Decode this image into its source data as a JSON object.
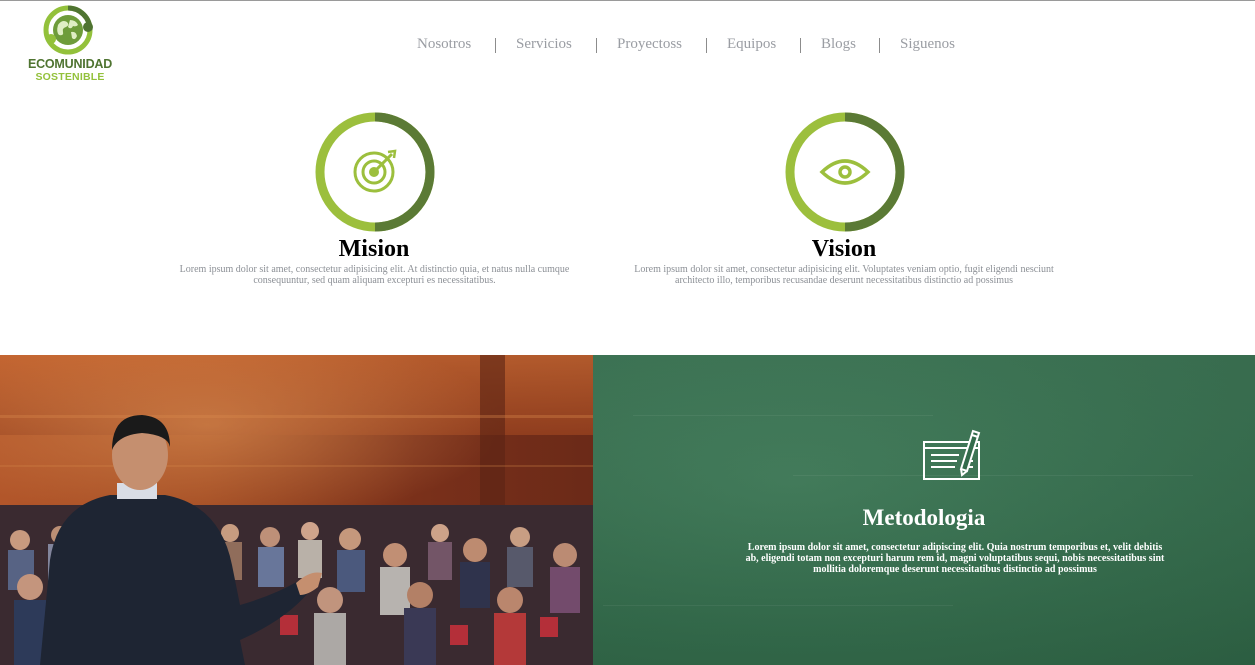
{
  "logo": {
    "line1": "ECOMUNIDAD",
    "line2": "SOSTENIBLE"
  },
  "nav": {
    "items": [
      "Nosotros",
      "Servicios",
      "Proyectoss",
      "Equipos",
      "Blogs",
      "Siguenos"
    ]
  },
  "features": [
    {
      "icon": "target-icon",
      "title": "Mision",
      "text": "Lorem ipsum dolor sit amet, consectetur adipisicing elit. At distinctio quia, et natus nulla cumque consequuntur, sed quam aliquam excepturi es necessitatibus."
    },
    {
      "icon": "eye-icon",
      "title": "Vision",
      "text": "Lorem ipsum dolor sit amet, consectetur adipisicing elit. Voluptates veniam optio, fugit eligendi nesciunt architecto illo, temporibus recusandae deserunt necessitatibus distinctio ad possimus"
    }
  ],
  "methodology": {
    "icon": "writing-pad-icon",
    "title": "Metodologia",
    "text": "Lorem ipsum dolor sit amet, consectetur adipiscing elit. Quia nostrum temporibus et, velit debitis ab, eligendi totam non excepturi harum rem id, magni voluptatibus sequi, nobis necessitatibus sint mollitia doloremque deserunt necessitatibus distinctio ad possimus"
  },
  "colors": {
    "light_green": "#9cbf3d",
    "dark_green": "#5b7a35",
    "board_green": "#336b4b",
    "nav_text": "#9a9da3"
  }
}
